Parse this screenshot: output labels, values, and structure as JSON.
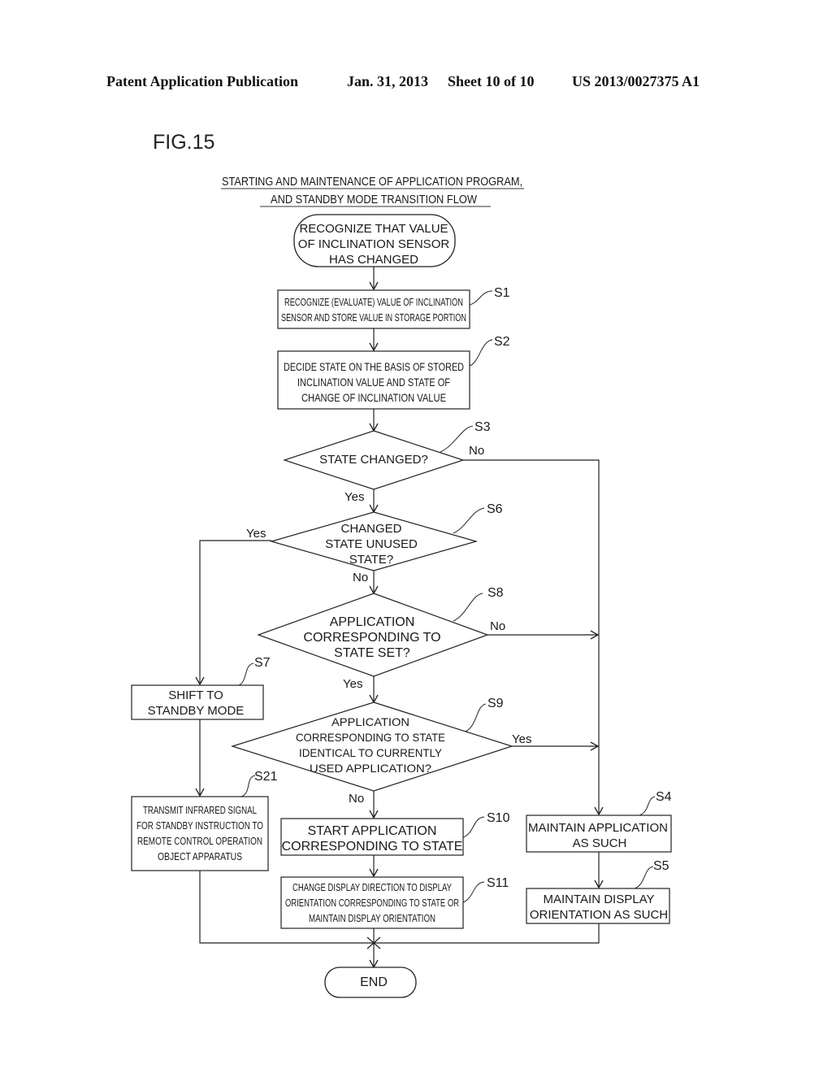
{
  "header": {
    "publication": "Patent Application Publication",
    "date": "Jan. 31, 2013",
    "sheet": "Sheet 10 of 10",
    "number": "US 2013/0027375 A1"
  },
  "figure_label": "FIG.15",
  "diagram": {
    "title": [
      "STARTING AND MAINTENANCE OF APPLICATION PROGRAM,",
      "AND STANDBY MODE TRANSITION FLOW"
    ],
    "start": [
      "RECOGNIZE THAT VALUE",
      "OF INCLINATION SENSOR",
      "HAS CHANGED"
    ],
    "end": "END",
    "steps": {
      "S1": {
        "label": "S1",
        "lines": [
          "RECOGNIZE (EVALUATE) VALUE OF INCLINATION",
          "SENSOR AND STORE VALUE IN STORAGE PORTION"
        ]
      },
      "S2": {
        "label": "S2",
        "lines": [
          "DECIDE STATE ON THE BASIS OF STORED",
          "INCLINATION VALUE AND STATE OF",
          "CHANGE OF  INCLINATION VALUE"
        ]
      },
      "S3": {
        "label": "S3",
        "lines": [
          "STATE CHANGED?"
        ]
      },
      "S4": {
        "label": "S4",
        "lines": [
          "MAINTAIN APPLICATION",
          "AS SUCH"
        ]
      },
      "S5": {
        "label": "S5",
        "lines": [
          "MAINTAIN DISPLAY",
          "ORIENTATION AS SUCH"
        ]
      },
      "S6": {
        "label": "S6",
        "lines": [
          "CHANGED",
          "STATE UNUSED",
          "STATE?"
        ]
      },
      "S7": {
        "label": "S7",
        "lines": [
          "SHIFT TO",
          "STANDBY MODE"
        ]
      },
      "S8": {
        "label": "S8",
        "lines": [
          "APPLICATION",
          "CORRESPONDING TO",
          "STATE SET?"
        ]
      },
      "S9": {
        "label": "S9",
        "lines": [
          "APPLICATION",
          "CORRESPONDING TO STATE",
          "IDENTICAL TO CURRENTLY",
          "USED APPLICATION?"
        ]
      },
      "S10": {
        "label": "S10",
        "lines": [
          "START APPLICATION",
          "CORRESPONDING TO STATE"
        ]
      },
      "S11": {
        "label": "S11",
        "lines": [
          "CHANGE DISPLAY DIRECTION TO DISPLAY",
          "ORIENTATION CORRESPONDING TO STATE OR",
          "MAINTAIN DISPLAY ORIENTATION"
        ]
      },
      "S21": {
        "label": "S21",
        "lines": [
          "TRANSMIT INFRARED SIGNAL",
          "FOR STANDBY INSTRUCTION TO",
          "REMOTE CONTROL OPERATION",
          "OBJECT APPARATUS"
        ]
      }
    },
    "branch_labels": {
      "S3_no": "No",
      "S3_yes": "Yes",
      "S6_yes": "Yes",
      "S6_no": "No",
      "S8_no": "No",
      "S8_yes": "Yes",
      "S9_yes": "Yes",
      "S9_no": "No"
    }
  }
}
